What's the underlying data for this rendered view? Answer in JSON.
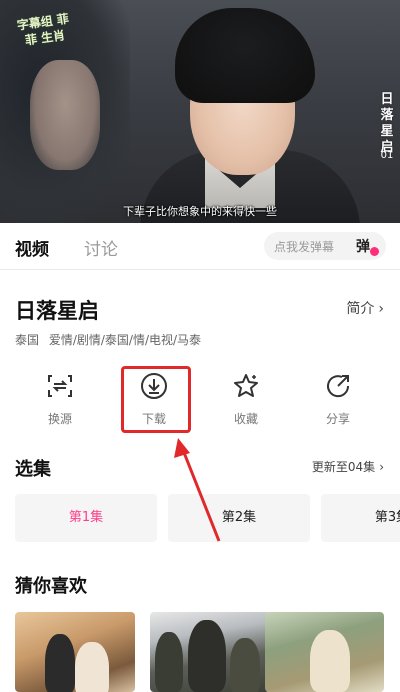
{
  "video": {
    "watermark": "字幕组 菲菲 生肖",
    "vertical_title": "日落星启",
    "vertical_episode": "01",
    "subtitle": "下辈子比你想象中的来得快一些"
  },
  "tabs": {
    "video_label": "视频",
    "discuss_label": "讨论",
    "danmu_placeholder": "点我发弹幕",
    "danmu_button": "弹"
  },
  "show": {
    "title": "日落星启",
    "intro_label": "简介",
    "tags": [
      "泰国",
      "爱情/剧情/泰国/情/电视/马泰"
    ]
  },
  "actions": [
    {
      "icon": "swap-source-icon",
      "label": "换源"
    },
    {
      "icon": "download-icon",
      "label": "下载"
    },
    {
      "icon": "star-icon",
      "label": "收藏"
    },
    {
      "icon": "share-icon",
      "label": "分享"
    }
  ],
  "episodes": {
    "title": "选集",
    "update_label": "更新至04集",
    "items": [
      "第1集",
      "第2集",
      "第3集"
    ],
    "selected_index": 0
  },
  "recommend": {
    "title": "猜你喜欢"
  },
  "colors": {
    "accent_pink": "#ff3d8a",
    "highlight_red": "#e0292b"
  }
}
